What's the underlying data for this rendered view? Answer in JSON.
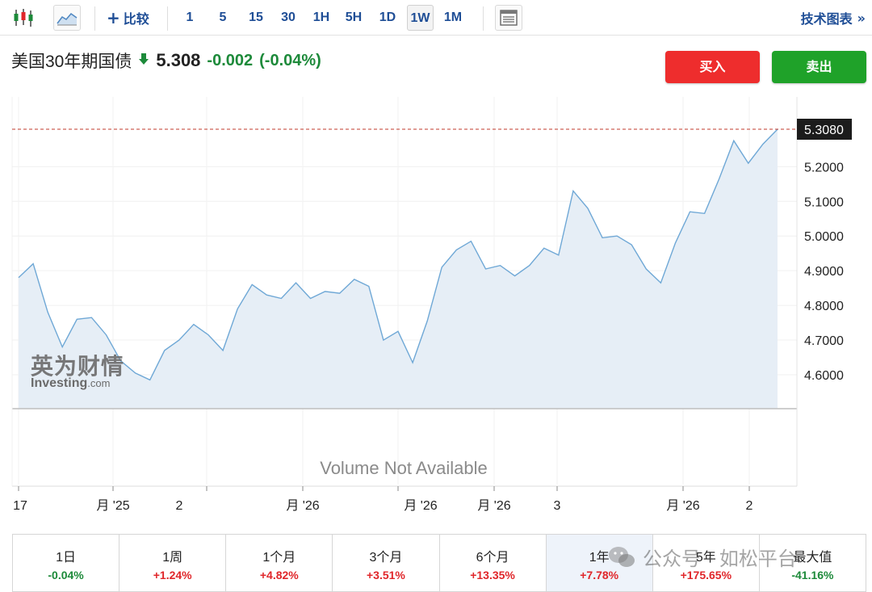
{
  "toolbar": {
    "compare_label": "比较",
    "intervals": [
      "1",
      "5",
      "15",
      "30",
      "1H",
      "5H",
      "1D",
      "1W",
      "1M"
    ],
    "active_interval": "1W",
    "tech_chart_label": "技术图表",
    "tech_chart_chevron": "»",
    "icons": [
      "candlestick-icon",
      "area-chart-icon",
      "plus-icon",
      "layout-icon",
      "arrow-down-icon"
    ]
  },
  "instrument": {
    "name": "美国30年期国债",
    "price": "5.308",
    "change": "-0.002",
    "change_pct": "(-0.04%)"
  },
  "trade": {
    "buy_label": "买入",
    "sell_label": "卖出"
  },
  "colors": {
    "link": "#1f4e96",
    "down": "#1d8a3a",
    "up": "#e0262a",
    "buy": "#ee2d2d",
    "sell": "#1fa229",
    "line": "#6fa8d6",
    "fill": "#e6eef6"
  },
  "chart_data": {
    "type": "area",
    "y": [
      4.88,
      4.92,
      4.78,
      4.68,
      4.76,
      4.765,
      4.715,
      4.64,
      4.605,
      4.585,
      4.67,
      4.7,
      4.745,
      4.715,
      4.67,
      4.79,
      4.86,
      4.83,
      4.82,
      4.865,
      4.82,
      4.84,
      4.835,
      4.875,
      4.855,
      4.7,
      4.725,
      4.635,
      4.755,
      4.91,
      4.96,
      4.985,
      4.905,
      4.915,
      4.885,
      4.915,
      4.965,
      4.945,
      5.13,
      5.08,
      4.995,
      5.0,
      4.975,
      4.905,
      4.865,
      4.98,
      5.07,
      5.065,
      5.165,
      5.275,
      5.21,
      5.265,
      5.308
    ],
    "x_tick_labels": [
      "17",
      "月 '25",
      "2",
      "月 '26",
      "月 '26",
      "月 '26",
      "3",
      "月 '26",
      "2"
    ],
    "y_tick_labels": [
      "5.2000",
      "5.1000",
      "5.0000",
      "4.9000",
      "4.8000",
      "4.7000",
      "4.6000"
    ],
    "y_ticks": [
      5.2,
      5.1,
      5.0,
      4.9,
      4.8,
      4.7,
      4.6
    ],
    "last_value_label": "5.3080",
    "last_value": 5.308,
    "volume_text": "Volume Not Available",
    "watermark_cn": "英为财情",
    "watermark_en_a": "Investing",
    "watermark_en_b": ".com",
    "grid": true
  },
  "periods": [
    {
      "label": "1日",
      "value": "-0.04%",
      "dir": "neg"
    },
    {
      "label": "1周",
      "value": "+1.24%",
      "dir": "pos"
    },
    {
      "label": "1个月",
      "value": "+4.82%",
      "dir": "pos"
    },
    {
      "label": "3个月",
      "value": "+3.51%",
      "dir": "pos"
    },
    {
      "label": "6个月",
      "value": "+13.35%",
      "dir": "pos"
    },
    {
      "label": "1年",
      "value": "+7.78%",
      "dir": "pos",
      "active": true
    },
    {
      "label": "5年",
      "value": "+175.65%",
      "dir": "pos"
    },
    {
      "label": "最大值",
      "value": "-41.16%",
      "dir": "neg"
    }
  ],
  "wechat_overlay": "公众号 · 如松平台"
}
